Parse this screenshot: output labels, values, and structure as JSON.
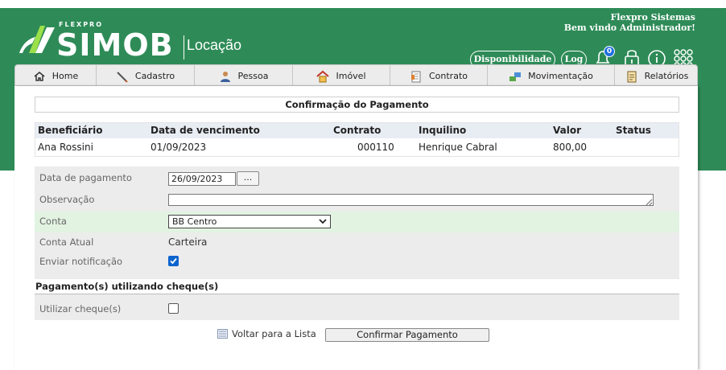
{
  "brand": {
    "small": "FLEXPRO",
    "name": "SIMOB",
    "product": "Locação",
    "color_primary": "#2e8b57"
  },
  "company": {
    "name": "Flexpro Sistemas",
    "welcome": "Bem vindo Administrador!"
  },
  "top_actions": {
    "availability_label": "Disponibilidade",
    "log_label": "Log",
    "notification_count": "0",
    "icons": [
      "bell-icon",
      "lock-icon",
      "info-icon",
      "grid-apps-icon"
    ]
  },
  "nav": [
    {
      "label": "Home",
      "icon": "home-icon"
    },
    {
      "label": "Cadastro",
      "icon": "pencil-icon"
    },
    {
      "label": "Pessoa",
      "icon": "person-icon"
    },
    {
      "label": "Imóvel",
      "icon": "house-icon"
    },
    {
      "label": "Contrato",
      "icon": "contract-icon"
    },
    {
      "label": "Movimentação",
      "icon": "transfer-icon"
    },
    {
      "label": "Relatórios",
      "icon": "report-icon"
    }
  ],
  "page": {
    "title": "Confirmação do Pagamento"
  },
  "table": {
    "headers": [
      "Beneficiário",
      "Data de vencimento",
      "Contrato",
      "Inquilino",
      "Valor",
      "Status"
    ],
    "rows": [
      [
        "Ana Rossini",
        "01/09/2023",
        "000110",
        "Henrique Cabral",
        "800,00",
        ""
      ]
    ]
  },
  "form": {
    "payment_date_label": "Data de pagamento",
    "payment_date_value": "26/09/2023",
    "date_picker_label": "...",
    "observation_label": "Observação",
    "observation_value": "",
    "account_label": "Conta",
    "account_value": "BB Centro",
    "current_account_label": "Conta Atual",
    "current_account_value": "Carteira",
    "notify_label": "Enviar notificação",
    "notify_checked": true,
    "cheque_section_title": "Pagamento(s) utilizando cheque(s)",
    "use_cheque_label": "Utilizar cheque(s)",
    "use_cheque_checked": false
  },
  "footer": {
    "back_label": "Voltar para a Lista",
    "confirm_label": "Confirmar Pagamento"
  }
}
